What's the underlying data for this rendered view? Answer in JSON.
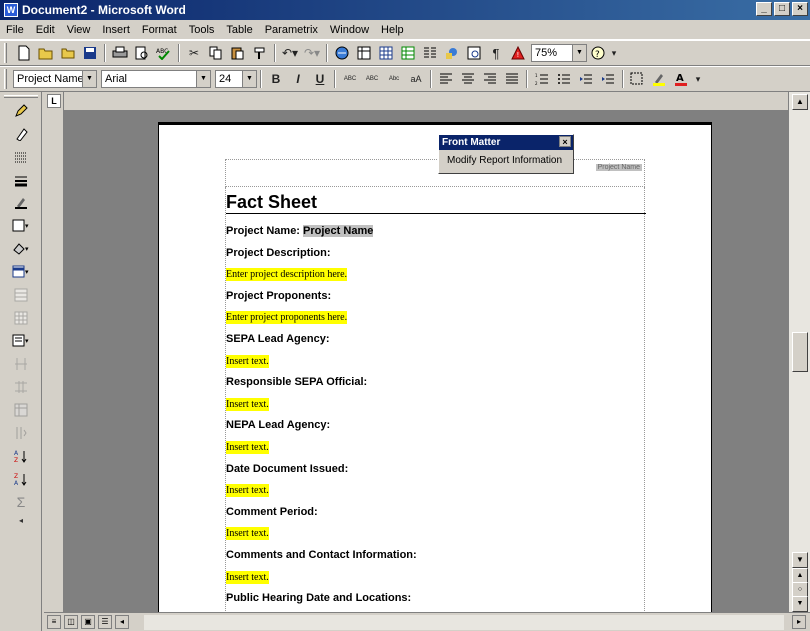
{
  "window": {
    "title": "Document2 - Microsoft Word",
    "min": "_",
    "max": "□",
    "close": "×"
  },
  "menu": [
    "File",
    "Edit",
    "View",
    "Insert",
    "Format",
    "Tools",
    "Table",
    "Parametrix",
    "Window",
    "Help"
  ],
  "toolbar": {
    "zoom": "75%",
    "style": "Project Name",
    "font": "Arial",
    "size": "24"
  },
  "front_matter": {
    "title": "Front Matter",
    "item": "Modify Report Information"
  },
  "header_tag": "Project Name",
  "doc": {
    "title": "Fact Sheet",
    "rows": [
      {
        "label": "Project Name: ",
        "value": "Project Name"
      },
      {
        "label": "Project Description:",
        "fill": "Enter project description here."
      },
      {
        "label": "Project Proponents:",
        "fill": "Enter project proponents here."
      },
      {
        "label": "SEPA Lead Agency:",
        "fill": "Insert text."
      },
      {
        "label": "Responsible SEPA Official:",
        "fill": "Insert text."
      },
      {
        "label": "NEPA Lead Agency:",
        "fill": "Insert text."
      },
      {
        "label": "Date Document Issued:",
        "fill": "Insert text."
      },
      {
        "label": "Comment Period:",
        "fill": "Insert text."
      },
      {
        "label": "Comments and Contact Information:",
        "fill": "Insert text."
      },
      {
        "label": "Public Hearing Date and Locations:",
        "fill": ""
      }
    ]
  }
}
